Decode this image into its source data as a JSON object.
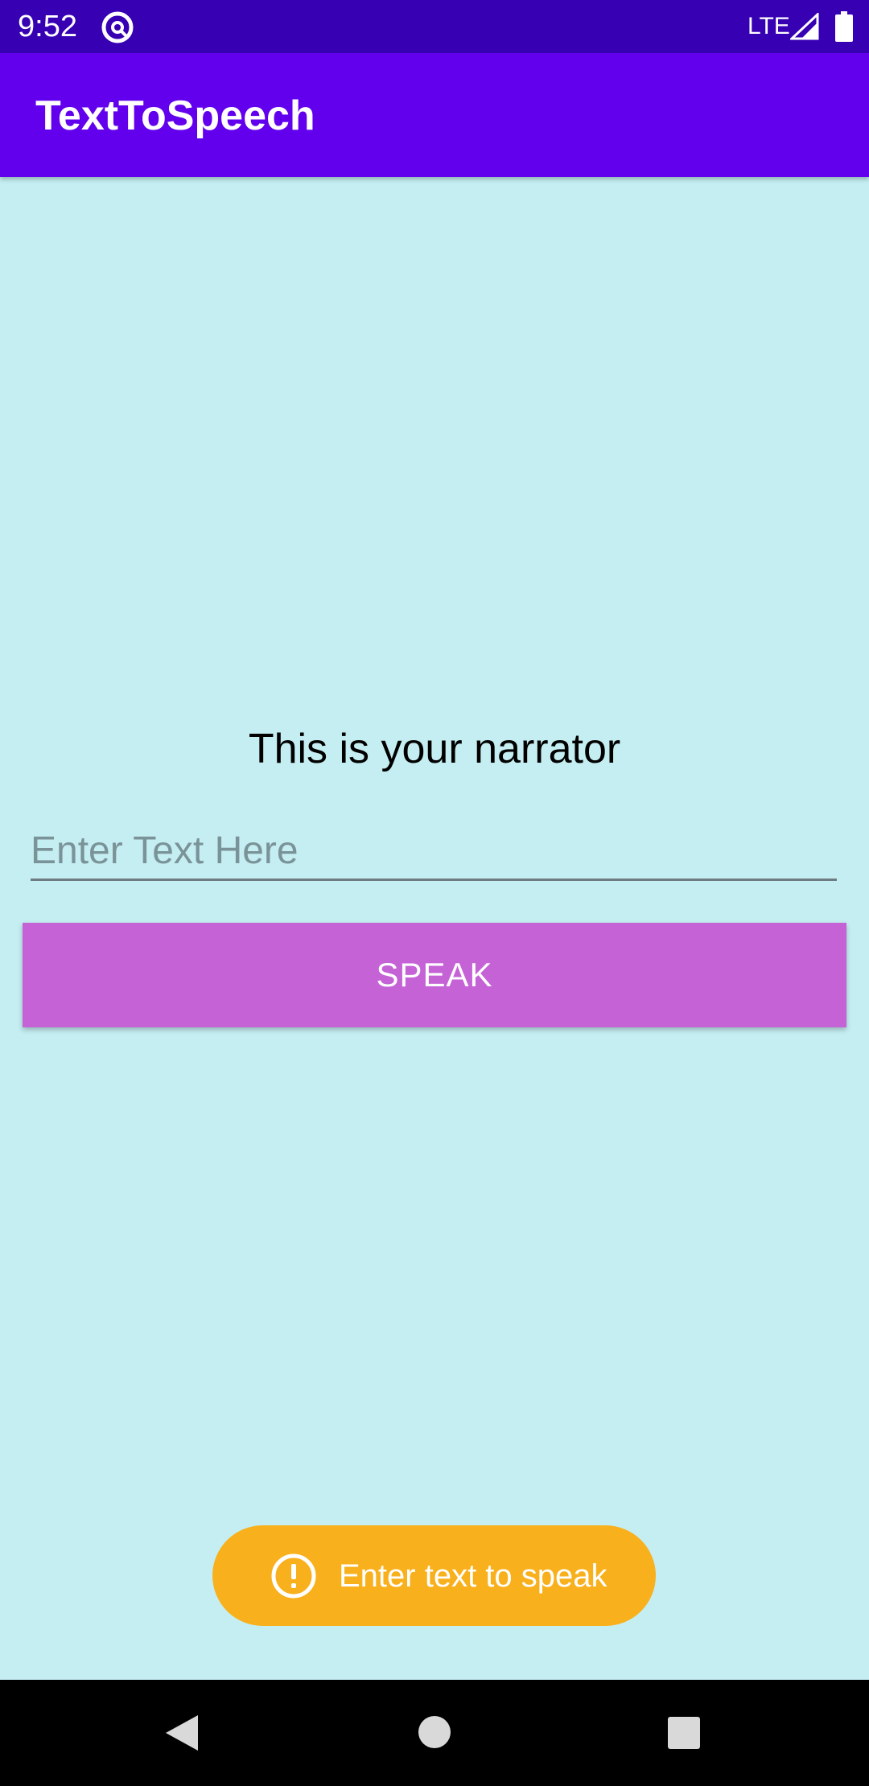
{
  "status_bar": {
    "time": "9:52",
    "network": "LTE",
    "icons": [
      "at-sign-icon",
      "signal-icon",
      "battery-icon"
    ]
  },
  "app_bar": {
    "title": "TextToSpeech"
  },
  "main": {
    "heading": "This is your narrator",
    "input": {
      "placeholder": "Enter Text Here",
      "value": ""
    },
    "speak_button_label": "SPEAK"
  },
  "toast": {
    "icon": "alert-circle-icon",
    "message": "Enter text to speak"
  },
  "nav_bar": {
    "icons": [
      "back-icon",
      "home-icon",
      "recents-icon"
    ]
  },
  "colors": {
    "status_bar": "#3700b3",
    "app_bar": "#6200ee",
    "background": "#c5eef2",
    "button": "#c462d6",
    "toast": "#f8b01c"
  }
}
